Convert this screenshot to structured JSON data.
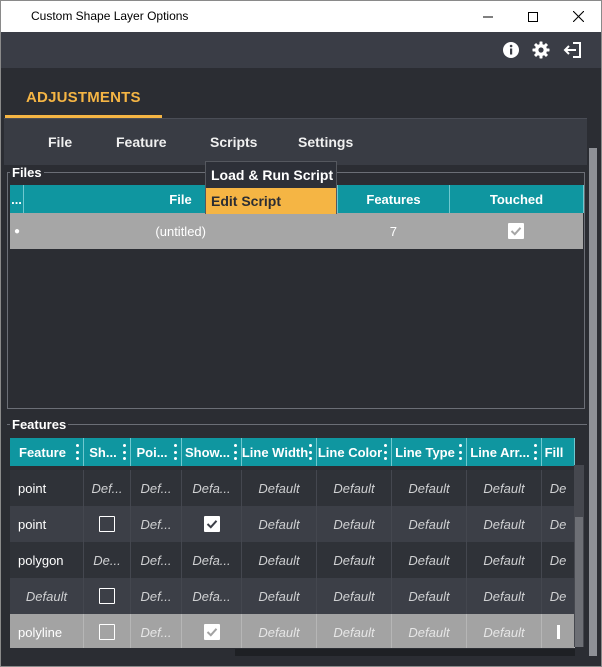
{
  "window": {
    "title": "Custom Shape Layer Options",
    "controls": [
      "minimize-icon",
      "maximize-icon",
      "close-icon"
    ]
  },
  "header": {
    "icons": [
      "info-icon",
      "gear-icon",
      "exit-icon"
    ]
  },
  "tabs": [
    {
      "label": "ADJUSTMENTS",
      "active": true
    }
  ],
  "menu": {
    "items": [
      "File",
      "Feature",
      "Scripts",
      "Settings"
    ],
    "open": "Scripts",
    "dropdown": [
      "Load & Run Script",
      "Edit Script"
    ],
    "highlighted": "Edit Script"
  },
  "files": {
    "label": "Files",
    "columns": [
      "...",
      "File",
      "Features",
      "Touched"
    ],
    "rows": [
      {
        "marker": "●",
        "file": "(untitled)",
        "features": "7",
        "touched": true
      }
    ]
  },
  "features": {
    "label": "Features",
    "columns": [
      "Feature",
      "Sh...",
      "Poi...",
      "Show...",
      "Line Width",
      "Line Color",
      "Line Type",
      "Line Arr...",
      "Fill"
    ],
    "rows": [
      {
        "feature": "point",
        "sh": "Def...",
        "poi": "Def...",
        "show": "Defa...",
        "lw": "Default",
        "lc": "Default",
        "lt": "Default",
        "la": "Default",
        "fill": "De"
      },
      {
        "feature": "point",
        "sh": "checkbox-off",
        "poi": "Def...",
        "show": "checkbox-on",
        "lw": "Default",
        "lc": "Default",
        "lt": "Default",
        "la": "Default",
        "fill": "De"
      },
      {
        "feature": "polygon",
        "sh": "De...",
        "poi": "Def...",
        "show": "Defa...",
        "lw": "Default",
        "lc": "Default",
        "lt": "Default",
        "la": "Default",
        "fill": "De"
      },
      {
        "feature": "Default",
        "sh": "checkbox-off",
        "poi": "Def...",
        "show": "Defa...",
        "lw": "Default",
        "lc": "Default",
        "lt": "Default",
        "la": "Default",
        "fill": "De"
      },
      {
        "feature": "polyline",
        "sh": "checkbox-off",
        "poi": "Def...",
        "show": "checkbox-on",
        "lw": "Default",
        "lc": "Default",
        "lt": "Default",
        "la": "Default",
        "fill": ""
      }
    ]
  },
  "colors": {
    "accent": "#f5b544",
    "header_teal": "#0f96a0",
    "background": "#2b2d33"
  }
}
